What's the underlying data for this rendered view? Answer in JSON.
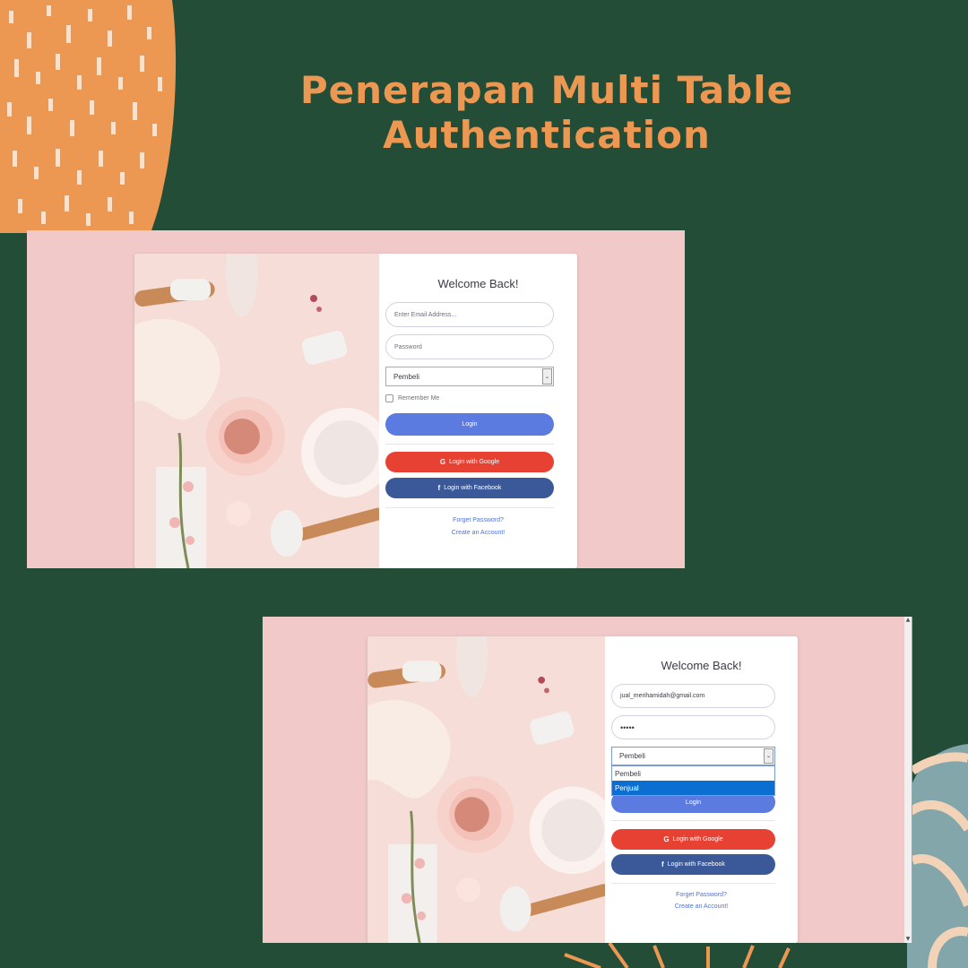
{
  "title": {
    "line1": "Penerapan Multi Table",
    "line2": "Authentication"
  },
  "colors": {
    "background": "#244d38",
    "accent_orange": "#ec9752",
    "panel_pink": "#f2c9c9",
    "login_blue": "#5b7be0",
    "google_red": "#e64133",
    "facebook_blue": "#3b5998",
    "link_blue": "#4e73df"
  },
  "screen1": {
    "heading": "Welcome Back!",
    "email_placeholder": "Enter Email Address...",
    "password_placeholder": "Password",
    "role_selected": "Pembeli",
    "remember_label": "Remember Me",
    "login_label": "Login",
    "google_label": "Login with Google",
    "facebook_label": "Login with Facebook",
    "forgot_label": "Forget Password?",
    "create_label": "Create an Account!"
  },
  "screen2": {
    "heading": "Welcome Back!",
    "email_value": "jual_merihamidah@gmail.com",
    "password_value": "•••••",
    "role_selected": "Pembeli",
    "role_options": [
      "Pembeli",
      "Penjual"
    ],
    "highlighted_option": "Penjual",
    "login_label": "Login",
    "google_label": "Login with Google",
    "facebook_label": "Login with Facebook",
    "forgot_label": "Forget Password?",
    "create_label": "Create an Account!"
  },
  "icons": {
    "google": "google-icon",
    "facebook": "facebook-icon",
    "select_arrow": "chevron-down-icon"
  }
}
